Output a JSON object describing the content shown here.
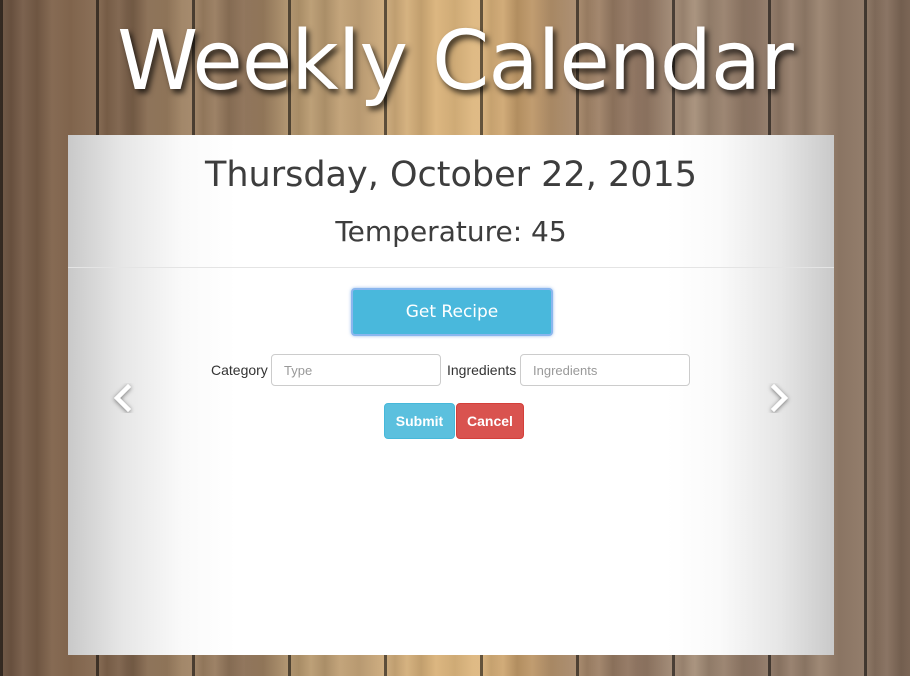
{
  "header": {
    "title": "Weekly Calendar"
  },
  "carousel": {
    "date": "Thursday, October 22, 2015",
    "temperature": "Temperature: 45",
    "get_recipe_label": "Get Recipe",
    "form": {
      "category_label": "Category",
      "category_placeholder": "Type",
      "ingredients_label": "Ingredients",
      "ingredients_placeholder": "Ingredients",
      "submit_label": "Submit",
      "cancel_label": "Cancel"
    },
    "prev_icon": "chevron-left-icon",
    "next_icon": "chevron-right-icon"
  },
  "colors": {
    "info": "#5bc0de",
    "danger": "#d9534f",
    "primary_button": "#49b8dc"
  }
}
